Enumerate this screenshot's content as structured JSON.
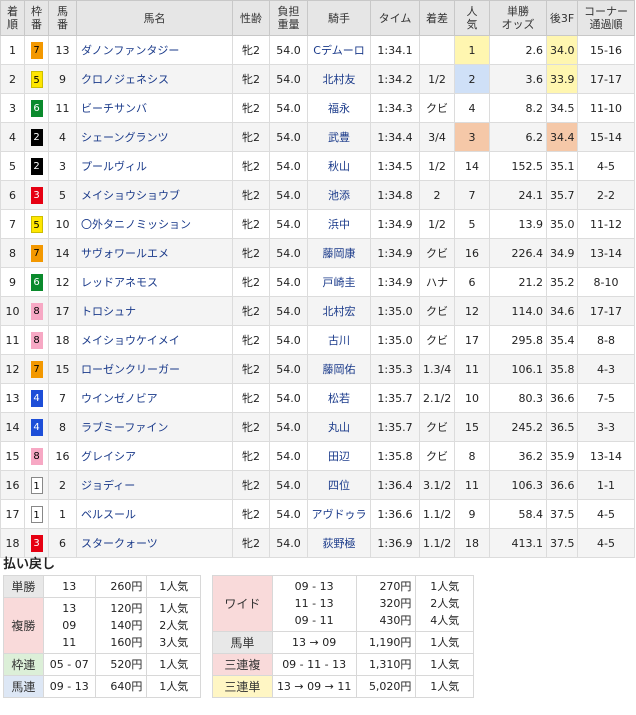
{
  "headers": [
    [
      "着",
      "順"
    ],
    [
      "枠",
      "番"
    ],
    [
      "馬",
      "番"
    ],
    [
      "馬名"
    ],
    [
      "性齢"
    ],
    [
      "負担",
      "重量"
    ],
    [
      "騎手"
    ],
    [
      "タイム"
    ],
    [
      "着差"
    ],
    [
      "人",
      "気"
    ],
    [
      "単勝",
      "オッズ"
    ],
    [
      "後3F"
    ],
    [
      "コーナー",
      "通過順"
    ]
  ],
  "rows": [
    {
      "pos": "1",
      "waku": "7",
      "uma": "13",
      "name": "ダノンファンタジー",
      "sex": "牝2",
      "wt": "54.0",
      "jockey": "Cデムーロ",
      "time": "1:34.1",
      "margin": "",
      "pop": "1",
      "odds": "2.6",
      "f3": "34.0",
      "corner": "15-16"
    },
    {
      "pos": "2",
      "waku": "5",
      "uma": "9",
      "name": "クロノジェネシス",
      "sex": "牝2",
      "wt": "54.0",
      "jockey": "北村友",
      "time": "1:34.2",
      "margin": "1/2",
      "pop": "2",
      "odds": "3.6",
      "f3": "33.9",
      "corner": "17-17"
    },
    {
      "pos": "3",
      "waku": "6",
      "uma": "11",
      "name": "ビーチサンバ",
      "sex": "牝2",
      "wt": "54.0",
      "jockey": "福永",
      "time": "1:34.3",
      "margin": "クビ",
      "pop": "4",
      "odds": "8.2",
      "f3": "34.5",
      "corner": "11-10"
    },
    {
      "pos": "4",
      "waku": "2",
      "uma": "4",
      "name": "シェーングランツ",
      "sex": "牝2",
      "wt": "54.0",
      "jockey": "武豊",
      "time": "1:34.4",
      "margin": "3/4",
      "pop": "3",
      "odds": "6.2",
      "f3": "34.4",
      "corner": "15-14"
    },
    {
      "pos": "5",
      "waku": "2",
      "uma": "3",
      "name": "プールヴィル",
      "sex": "牝2",
      "wt": "54.0",
      "jockey": "秋山",
      "time": "1:34.5",
      "margin": "1/2",
      "pop": "14",
      "odds": "152.5",
      "f3": "35.1",
      "corner": "4-5"
    },
    {
      "pos": "6",
      "waku": "3",
      "uma": "5",
      "name": "メイショウショウブ",
      "sex": "牝2",
      "wt": "54.0",
      "jockey": "池添",
      "time": "1:34.8",
      "margin": "2",
      "pop": "7",
      "odds": "24.1",
      "f3": "35.7",
      "corner": "2-2"
    },
    {
      "pos": "7",
      "waku": "5",
      "uma": "10",
      "name": "〇外タニノミッション",
      "sex": "牝2",
      "wt": "54.0",
      "jockey": "浜中",
      "time": "1:34.9",
      "margin": "1/2",
      "pop": "5",
      "odds": "13.9",
      "f3": "35.0",
      "corner": "11-12"
    },
    {
      "pos": "8",
      "waku": "7",
      "uma": "14",
      "name": "サヴォワールエメ",
      "sex": "牝2",
      "wt": "54.0",
      "jockey": "藤岡康",
      "time": "1:34.9",
      "margin": "クビ",
      "pop": "16",
      "odds": "226.4",
      "f3": "34.9",
      "corner": "13-14"
    },
    {
      "pos": "9",
      "waku": "6",
      "uma": "12",
      "name": "レッドアネモス",
      "sex": "牝2",
      "wt": "54.0",
      "jockey": "戸崎圭",
      "time": "1:34.9",
      "margin": "ハナ",
      "pop": "6",
      "odds": "21.2",
      "f3": "35.2",
      "corner": "8-10"
    },
    {
      "pos": "10",
      "waku": "8",
      "uma": "17",
      "name": "トロシュナ",
      "sex": "牝2",
      "wt": "54.0",
      "jockey": "北村宏",
      "time": "1:35.0",
      "margin": "クビ",
      "pop": "12",
      "odds": "114.0",
      "f3": "34.6",
      "corner": "17-17"
    },
    {
      "pos": "11",
      "waku": "8",
      "uma": "18",
      "name": "メイショウケイメイ",
      "sex": "牝2",
      "wt": "54.0",
      "jockey": "古川",
      "time": "1:35.0",
      "margin": "クビ",
      "pop": "17",
      "odds": "295.8",
      "f3": "35.4",
      "corner": "8-8"
    },
    {
      "pos": "12",
      "waku": "7",
      "uma": "15",
      "name": "ローゼンクリーガー",
      "sex": "牝2",
      "wt": "54.0",
      "jockey": "藤岡佑",
      "time": "1:35.3",
      "margin": "1.3/4",
      "pop": "11",
      "odds": "106.1",
      "f3": "35.8",
      "corner": "4-3"
    },
    {
      "pos": "13",
      "waku": "4",
      "uma": "7",
      "name": "ウインゼノビア",
      "sex": "牝2",
      "wt": "54.0",
      "jockey": "松若",
      "time": "1:35.7",
      "margin": "2.1/2",
      "pop": "10",
      "odds": "80.3",
      "f3": "36.6",
      "corner": "7-5"
    },
    {
      "pos": "14",
      "waku": "4",
      "uma": "8",
      "name": "ラブミーファイン",
      "sex": "牝2",
      "wt": "54.0",
      "jockey": "丸山",
      "time": "1:35.7",
      "margin": "クビ",
      "pop": "15",
      "odds": "245.2",
      "f3": "36.5",
      "corner": "3-3"
    },
    {
      "pos": "15",
      "waku": "8",
      "uma": "16",
      "name": "グレイシア",
      "sex": "牝2",
      "wt": "54.0",
      "jockey": "田辺",
      "time": "1:35.8",
      "margin": "クビ",
      "pop": "8",
      "odds": "36.2",
      "f3": "35.9",
      "corner": "13-14"
    },
    {
      "pos": "16",
      "waku": "1",
      "uma": "2",
      "name": "ジョディー",
      "sex": "牝2",
      "wt": "54.0",
      "jockey": "四位",
      "time": "1:36.4",
      "margin": "3.1/2",
      "pop": "11",
      "odds": "106.3",
      "f3": "36.6",
      "corner": "1-1"
    },
    {
      "pos": "17",
      "waku": "1",
      "uma": "1",
      "name": "ベルスール",
      "sex": "牝2",
      "wt": "54.0",
      "jockey": "アヴドゥラ",
      "time": "1:36.6",
      "margin": "1.1/2",
      "pop": "9",
      "odds": "58.4",
      "f3": "37.5",
      "corner": "4-5"
    },
    {
      "pos": "18",
      "waku": "3",
      "uma": "6",
      "name": "スタークォーツ",
      "sex": "牝2",
      "wt": "54.0",
      "jockey": "荻野極",
      "time": "1:36.9",
      "margin": "1.1/2",
      "pop": "18",
      "odds": "413.1",
      "f3": "37.5",
      "corner": "4-5"
    }
  ],
  "payouts_title": "払い戻し",
  "payouts_left": [
    {
      "label": "単勝",
      "cls": "lbl-win",
      "nums": [
        "13"
      ],
      "yen": [
        "260円"
      ],
      "pop": [
        "1人気"
      ]
    },
    {
      "label": "複勝",
      "cls": "lbl-place",
      "nums": [
        "13",
        "09",
        "11"
      ],
      "yen": [
        "120円",
        "140円",
        "160円"
      ],
      "pop": [
        "1人気",
        "2人気",
        "3人気"
      ]
    },
    {
      "label": "枠連",
      "cls": "lbl-wakuren",
      "nums": [
        "05 - 07"
      ],
      "yen": [
        "520円"
      ],
      "pop": [
        "1人気"
      ]
    },
    {
      "label": "馬連",
      "cls": "lbl-umaren",
      "nums": [
        "09 - 13"
      ],
      "yen": [
        "640円"
      ],
      "pop": [
        "1人気"
      ]
    }
  ],
  "payouts_right": [
    {
      "label": "ワイド",
      "cls": "lbl-wide",
      "nums": [
        "09 - 13",
        "11 - 13",
        "09 - 11"
      ],
      "yen": [
        "270円",
        "320円",
        "430円"
      ],
      "pop": [
        "1人気",
        "2人気",
        "4人気"
      ]
    },
    {
      "label": "馬単",
      "cls": "lbl-umatan",
      "nums": [
        "13 → 09"
      ],
      "yen": [
        "1,190円"
      ],
      "pop": [
        "1人気"
      ]
    },
    {
      "label": "三連複",
      "cls": "lbl-sanfuku",
      "nums": [
        "09 - 11 - 13"
      ],
      "yen": [
        "1,310円"
      ],
      "pop": [
        "1人気"
      ]
    },
    {
      "label": "三連単",
      "cls": "lbl-santan",
      "nums": [
        "13 → 09 → 11"
      ],
      "yen": [
        "5,020円"
      ],
      "pop": [
        "1人気"
      ]
    }
  ]
}
